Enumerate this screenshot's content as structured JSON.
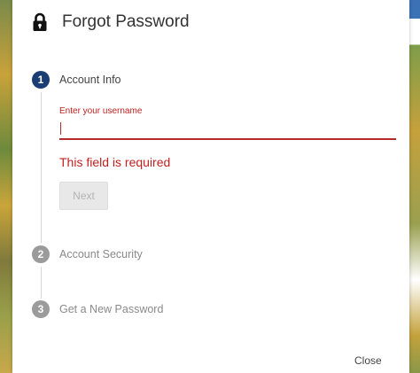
{
  "dialog": {
    "title": "Forgot Password",
    "close_label": "Close"
  },
  "steps": [
    {
      "number": "1",
      "label": "Account Info",
      "state": "active"
    },
    {
      "number": "2",
      "label": "Account Security",
      "state": "inactive"
    },
    {
      "number": "3",
      "label": "Get a New Password",
      "state": "inactive"
    }
  ],
  "form": {
    "username_label": "Enter your username",
    "username_value": "",
    "error_message": "This field is required",
    "next_label": "Next"
  },
  "colors": {
    "step_active": "#1a3e73",
    "step_inactive": "#9b9b9b",
    "error": "#c21f1f",
    "window_frame": "#4a7bbd"
  },
  "icons": {
    "lock": "lock-icon"
  }
}
